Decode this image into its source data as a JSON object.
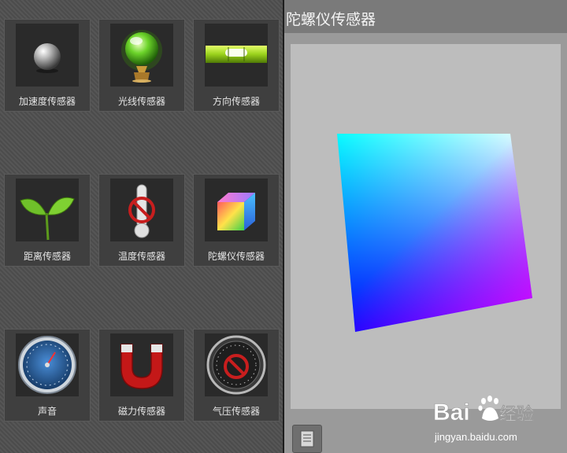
{
  "sensors": [
    {
      "label": "加速度传感器",
      "icon": "steel-ball-icon"
    },
    {
      "label": "光线传感器",
      "icon": "green-orb-icon"
    },
    {
      "label": "方向传感器",
      "icon": "spirit-level-icon"
    },
    {
      "label": "距离传感器",
      "icon": "sprout-icon"
    },
    {
      "label": "温度传感器",
      "icon": "thermometer-disabled-icon"
    },
    {
      "label": "陀螺仪传感器",
      "icon": "color-cube-icon"
    },
    {
      "label": "声音",
      "icon": "gauge-icon"
    },
    {
      "label": "磁力传感器",
      "icon": "magnet-icon"
    },
    {
      "label": "气压传感器",
      "icon": "barometer-disabled-icon"
    }
  ],
  "detail": {
    "title": "陀螺仪传感器"
  },
  "watermark": {
    "brand": "Bai du 经验",
    "url": "jingyan.baidu.com"
  },
  "colors": {
    "panel_bg": "#4c4c4c",
    "tile_bg": "#3f3f3f",
    "detail_bg": "#9a9a9a",
    "canvas_bg": "#bdbdbd"
  }
}
